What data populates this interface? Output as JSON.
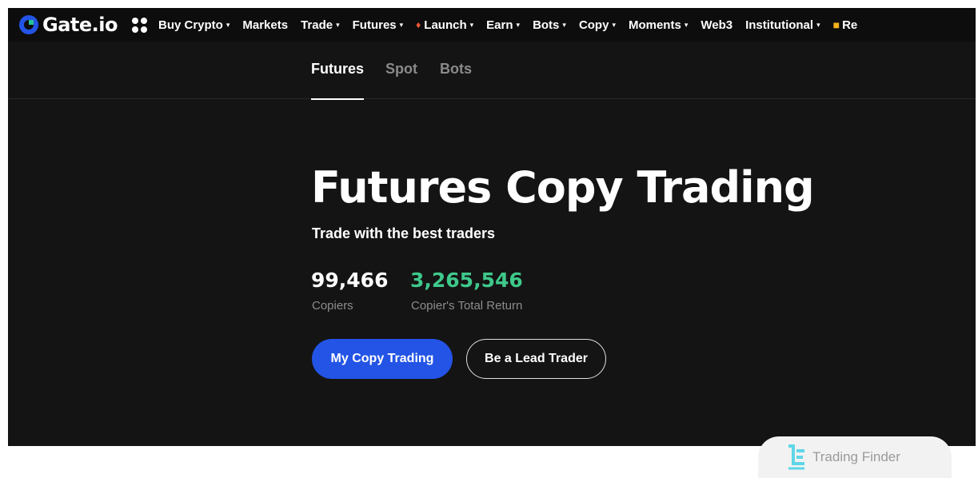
{
  "brand": {
    "name": "Gate.io",
    "accent": "#2354e6",
    "positive": "#3ec98b"
  },
  "nav": {
    "items": [
      {
        "label": "Buy Crypto",
        "caret": "▾"
      },
      {
        "label": "Markets",
        "caret": ""
      },
      {
        "label": "Trade",
        "caret": "▾"
      },
      {
        "label": "Futures",
        "caret": "▾"
      },
      {
        "label": "Launch",
        "caret": "▾",
        "icon": "flame-icon"
      },
      {
        "label": "Earn",
        "caret": "▾"
      },
      {
        "label": "Bots",
        "caret": "▾"
      },
      {
        "label": "Copy",
        "caret": "▾"
      },
      {
        "label": "Moments",
        "caret": "▾"
      },
      {
        "label": "Web3",
        "caret": ""
      },
      {
        "label": "Institutional",
        "caret": "▾"
      },
      {
        "label": "Re",
        "caret": "",
        "icon": "gift-icon"
      }
    ]
  },
  "tabs": [
    {
      "label": "Futures",
      "active": true
    },
    {
      "label": "Spot",
      "active": false
    },
    {
      "label": "Bots",
      "active": false
    }
  ],
  "hero": {
    "title": "Futures Copy Trading",
    "subtitle": "Trade with the best traders"
  },
  "stats": {
    "copiers": {
      "value": "99,466",
      "label": "Copiers"
    },
    "total_return": {
      "value": "3,265,546",
      "label": "Copier's Total Return"
    }
  },
  "buttons": {
    "my_copy_trading": "My Copy Trading",
    "be_lead_trader": "Be a Lead Trader"
  },
  "watermark": {
    "text": "Trading Finder"
  }
}
